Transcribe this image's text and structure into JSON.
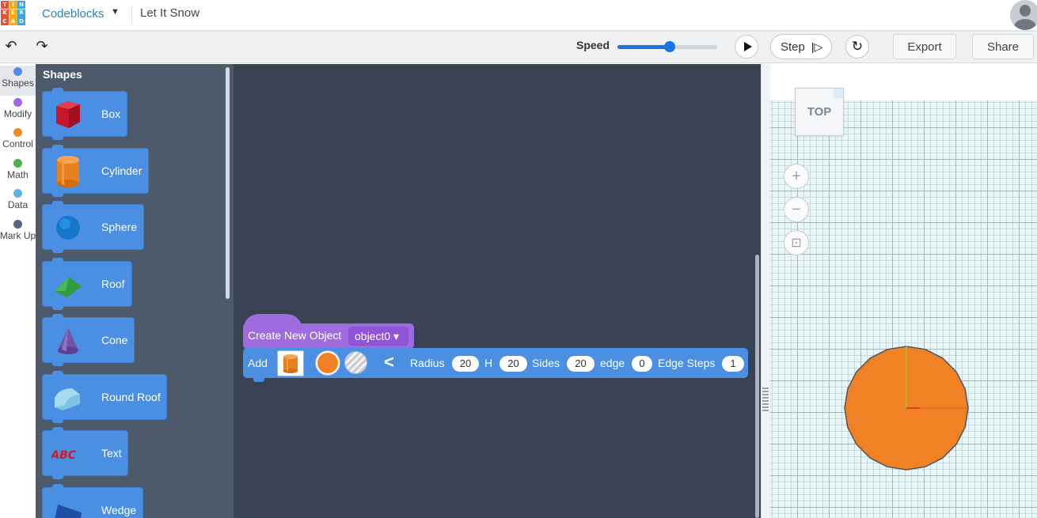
{
  "header": {
    "logo_letters": [
      "TIN",
      "KER",
      "CAD"
    ],
    "app_name": "Codeblocks",
    "project_title": "Let It Snow",
    "logo_colors": [
      "#e94f37",
      "#f7a81b",
      "#3aa9d6",
      "#e94f37",
      "#f7a81b",
      "#3aa9d6",
      "#e94f37",
      "#f7a81b",
      "#3aa9d6"
    ]
  },
  "toolbar": {
    "undo_icon": "↶",
    "redo_icon": "↷",
    "speed_label": "Speed",
    "speed_value": 0.52,
    "step_label": "Step",
    "export_label": "Export",
    "share_label": "Share"
  },
  "categories": [
    {
      "label": "Shapes",
      "color": "#4d8fe6",
      "active": true
    },
    {
      "label": "Modify",
      "color": "#9d68e0",
      "active": false
    },
    {
      "label": "Control",
      "color": "#f08b24",
      "active": false
    },
    {
      "label": "Math",
      "color": "#4caf50",
      "active": false
    },
    {
      "label": "Data",
      "color": "#5ab4e5",
      "active": false
    },
    {
      "label": "Mark Up",
      "color": "#57657a",
      "active": false
    }
  ],
  "flyout": {
    "title": "Shapes",
    "blocks": [
      {
        "name": "Box",
        "icon": "box-icon"
      },
      {
        "name": "Cylinder",
        "icon": "cylinder-icon"
      },
      {
        "name": "Sphere",
        "icon": "sphere-icon"
      },
      {
        "name": "Roof",
        "icon": "roof-icon"
      },
      {
        "name": "Cone",
        "icon": "cone-icon"
      },
      {
        "name": "Round Roof",
        "icon": "round-roof-icon"
      },
      {
        "name": "Text",
        "icon": "text-shape-icon"
      },
      {
        "name": "Wedge",
        "icon": "wedge-icon"
      }
    ]
  },
  "workspace": {
    "create_label": "Create New Object",
    "object_name": "object0 ▾",
    "add_label": "Add",
    "color": "#f08124",
    "params": [
      {
        "label": "Radius",
        "value": "20"
      },
      {
        "label": "H",
        "value": "20"
      },
      {
        "label": "Sides",
        "value": "20"
      },
      {
        "label": "edge",
        "value": "0"
      },
      {
        "label": "Edge Steps",
        "value": "1"
      }
    ]
  },
  "viewport": {
    "view_cube_label": "TOP",
    "zoom_in_icon": "+",
    "zoom_out_icon": "−",
    "fit_icon": "⊡",
    "object_color": "#f08124"
  }
}
